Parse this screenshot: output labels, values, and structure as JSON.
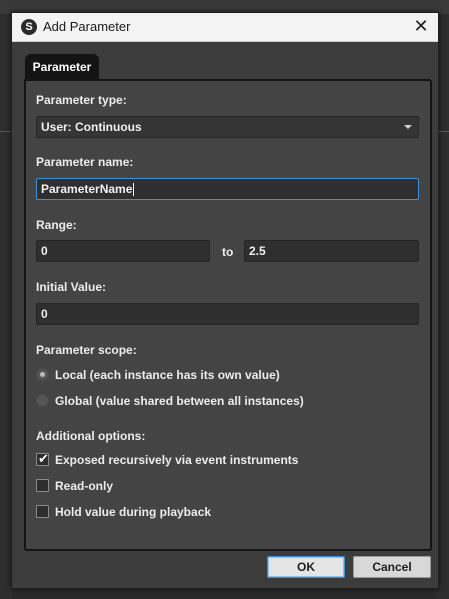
{
  "window": {
    "title": "Add Parameter",
    "app_icon": "fmod-logo-icon",
    "close_glyph": "✕"
  },
  "tabs": [
    {
      "label": "Parameter",
      "active": true
    }
  ],
  "form": {
    "parameter_type": {
      "label": "Parameter type:",
      "selected": "User: Continuous"
    },
    "parameter_name": {
      "label": "Parameter name:",
      "value": "ParameterName"
    },
    "range": {
      "label": "Range:",
      "min": "0",
      "to_label": "to",
      "max": "2.5"
    },
    "initial_value": {
      "label": "Initial Value:",
      "value": "0"
    },
    "scope": {
      "label": "Parameter scope:",
      "options": [
        {
          "label": "Local (each instance has its own value)",
          "checked": true
        },
        {
          "label": "Global (value shared between all instances)",
          "checked": false
        }
      ]
    },
    "additional": {
      "label": "Additional options:",
      "options": [
        {
          "label": "Exposed recursively via event instruments",
          "checked": true
        },
        {
          "label": "Read-only",
          "checked": false
        },
        {
          "label": "Hold value during playback",
          "checked": false
        }
      ]
    }
  },
  "buttons": {
    "ok": "OK",
    "cancel": "Cancel"
  },
  "colors": {
    "focus_accent": "#3d8fd8",
    "panel_bg": "#444444",
    "titlebar_bg": "#f3f3f3"
  }
}
